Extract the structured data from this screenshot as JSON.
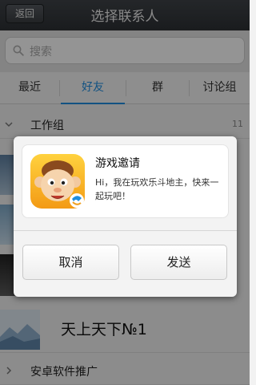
{
  "header": {
    "back_label": "返回",
    "title": "选择联系人"
  },
  "search": {
    "placeholder": "搜索"
  },
  "tabs": [
    {
      "label": "最近",
      "active": false
    },
    {
      "label": "好友",
      "active": true
    },
    {
      "label": "群",
      "active": false
    },
    {
      "label": "讨论组",
      "active": false
    }
  ],
  "list": {
    "group_top": {
      "label": "工作组",
      "count": "11"
    },
    "contact": {
      "name": "天上天下№1"
    },
    "group_bottom": {
      "label": "安卓软件推广"
    }
  },
  "dialog": {
    "card_title": "游戏邀请",
    "card_message": "Hi，我在玩欢乐斗地主，快来一起玩吧！",
    "cancel_label": "取消",
    "send_label": "发送"
  },
  "colors": {
    "accent": "#1f8ee0",
    "titlebar": "#35383c",
    "overlay": "rgba(0,0,0,0.42)"
  }
}
